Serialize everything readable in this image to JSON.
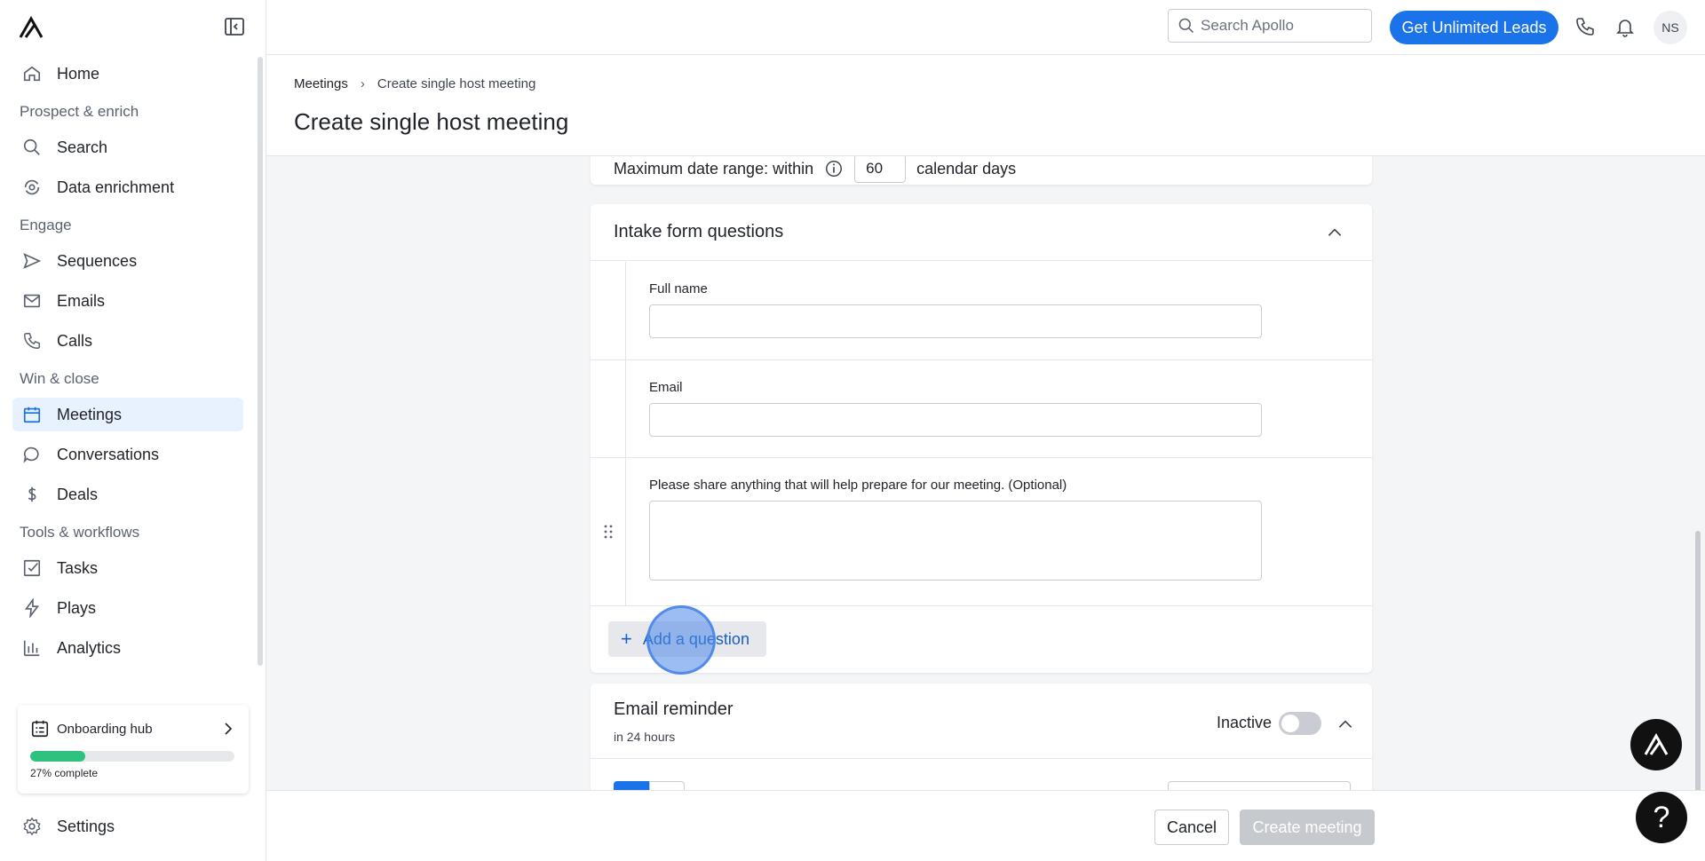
{
  "sidebar": {
    "items": [
      {
        "label": "Home",
        "icon": "home-icon"
      },
      {
        "section": "Prospect & enrich"
      },
      {
        "label": "Search",
        "icon": "search-icon"
      },
      {
        "label": "Data enrichment",
        "icon": "enrichment-icon"
      },
      {
        "section": "Engage"
      },
      {
        "label": "Sequences",
        "icon": "send-icon"
      },
      {
        "label": "Emails",
        "icon": "mail-icon"
      },
      {
        "label": "Calls",
        "icon": "phone-icon"
      },
      {
        "section": "Win & close"
      },
      {
        "label": "Meetings",
        "icon": "calendar-icon",
        "active": true
      },
      {
        "label": "Conversations",
        "icon": "chat-icon"
      },
      {
        "label": "Deals",
        "icon": "dollar-icon"
      },
      {
        "section": "Tools & workflows"
      },
      {
        "label": "Tasks",
        "icon": "checkbox-icon"
      },
      {
        "label": "Plays",
        "icon": "bolt-icon"
      },
      {
        "label": "Analytics",
        "icon": "bar-chart-icon"
      }
    ],
    "onboarding": {
      "label": "Onboarding hub",
      "progress_text": "27% complete",
      "progress": 0.27
    },
    "settings_label": "Settings"
  },
  "topbar": {
    "search_placeholder": "Search Apollo",
    "cta_label": "Get Unlimited Leads",
    "avatar_initials": "NS",
    "accent": "#1a73e8"
  },
  "header": {
    "breadcrumb": [
      "Meetings",
      "Create single host meeting"
    ],
    "title": "Create single host meeting"
  },
  "date_range": {
    "label": "Maximum date range: within",
    "value": "60",
    "suffix": "calendar days"
  },
  "intake": {
    "title": "Intake form questions",
    "questions": [
      {
        "label": "Full name"
      },
      {
        "label": "Email"
      },
      {
        "label": "Please share anything that will help prepare for our meeting. (Optional)"
      }
    ],
    "add_label": "Add a question"
  },
  "email_reminder": {
    "title": "Email reminder",
    "subtitle": "in 24 hours",
    "status": "Inactive"
  },
  "footer": {
    "cancel_label": "Cancel",
    "create_label": "Create meeting"
  },
  "help_label": "?"
}
